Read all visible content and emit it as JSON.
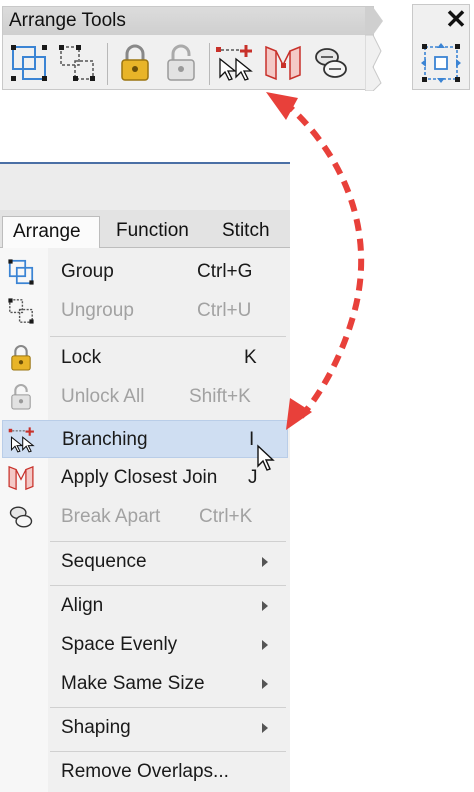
{
  "toolbar": {
    "title": "Arrange Tools",
    "tools": [
      {
        "icon": "group-icon"
      },
      {
        "icon": "ungroup-icon"
      },
      {
        "icon": "lock-icon"
      },
      {
        "icon": "unlock-icon"
      },
      {
        "icon": "branching-icon"
      },
      {
        "icon": "apply-closest-join-icon"
      },
      {
        "icon": "break-apart-icon"
      }
    ]
  },
  "side_panel": {
    "close_label": "✕",
    "tool_icon": "arrange-move-icon"
  },
  "tabs": [
    {
      "label": "Arrange",
      "active": true
    },
    {
      "label": "Function",
      "active": false
    },
    {
      "label": "Stitch",
      "active": false
    }
  ],
  "menu": {
    "items": [
      {
        "label": "Group",
        "shortcut": "Ctrl+G",
        "icon": "group-icon",
        "disabled": false
      },
      {
        "label": "Ungroup",
        "shortcut": "Ctrl+U",
        "icon": "ungroup-icon",
        "disabled": true
      },
      {
        "label": "Lock",
        "shortcut": "K",
        "icon": "lock-icon",
        "disabled": false
      },
      {
        "label": "Unlock All",
        "shortcut": "Shift+K",
        "icon": "unlock-icon",
        "disabled": true
      },
      {
        "label": "Branching",
        "shortcut": "I",
        "icon": "branching-icon",
        "disabled": false,
        "highlighted": true
      },
      {
        "label": "Apply Closest Join",
        "shortcut": "J",
        "icon": "apply-closest-join-icon",
        "disabled": false
      },
      {
        "label": "Break Apart",
        "shortcut": "Ctrl+K",
        "icon": "break-apart-icon",
        "disabled": true
      },
      {
        "label": "Sequence",
        "submenu": true
      },
      {
        "label": "Align",
        "submenu": true
      },
      {
        "label": "Space Evenly",
        "submenu": true
      },
      {
        "label": "Make Same Size",
        "submenu": true
      },
      {
        "label": "Shaping",
        "submenu": true
      },
      {
        "label": "Remove Overlaps...",
        "submenu": false
      }
    ]
  },
  "colors": {
    "highlight": "#cfdef2",
    "annotation_arrow": "#e8403a",
    "lock_gold": "#e8b428"
  }
}
